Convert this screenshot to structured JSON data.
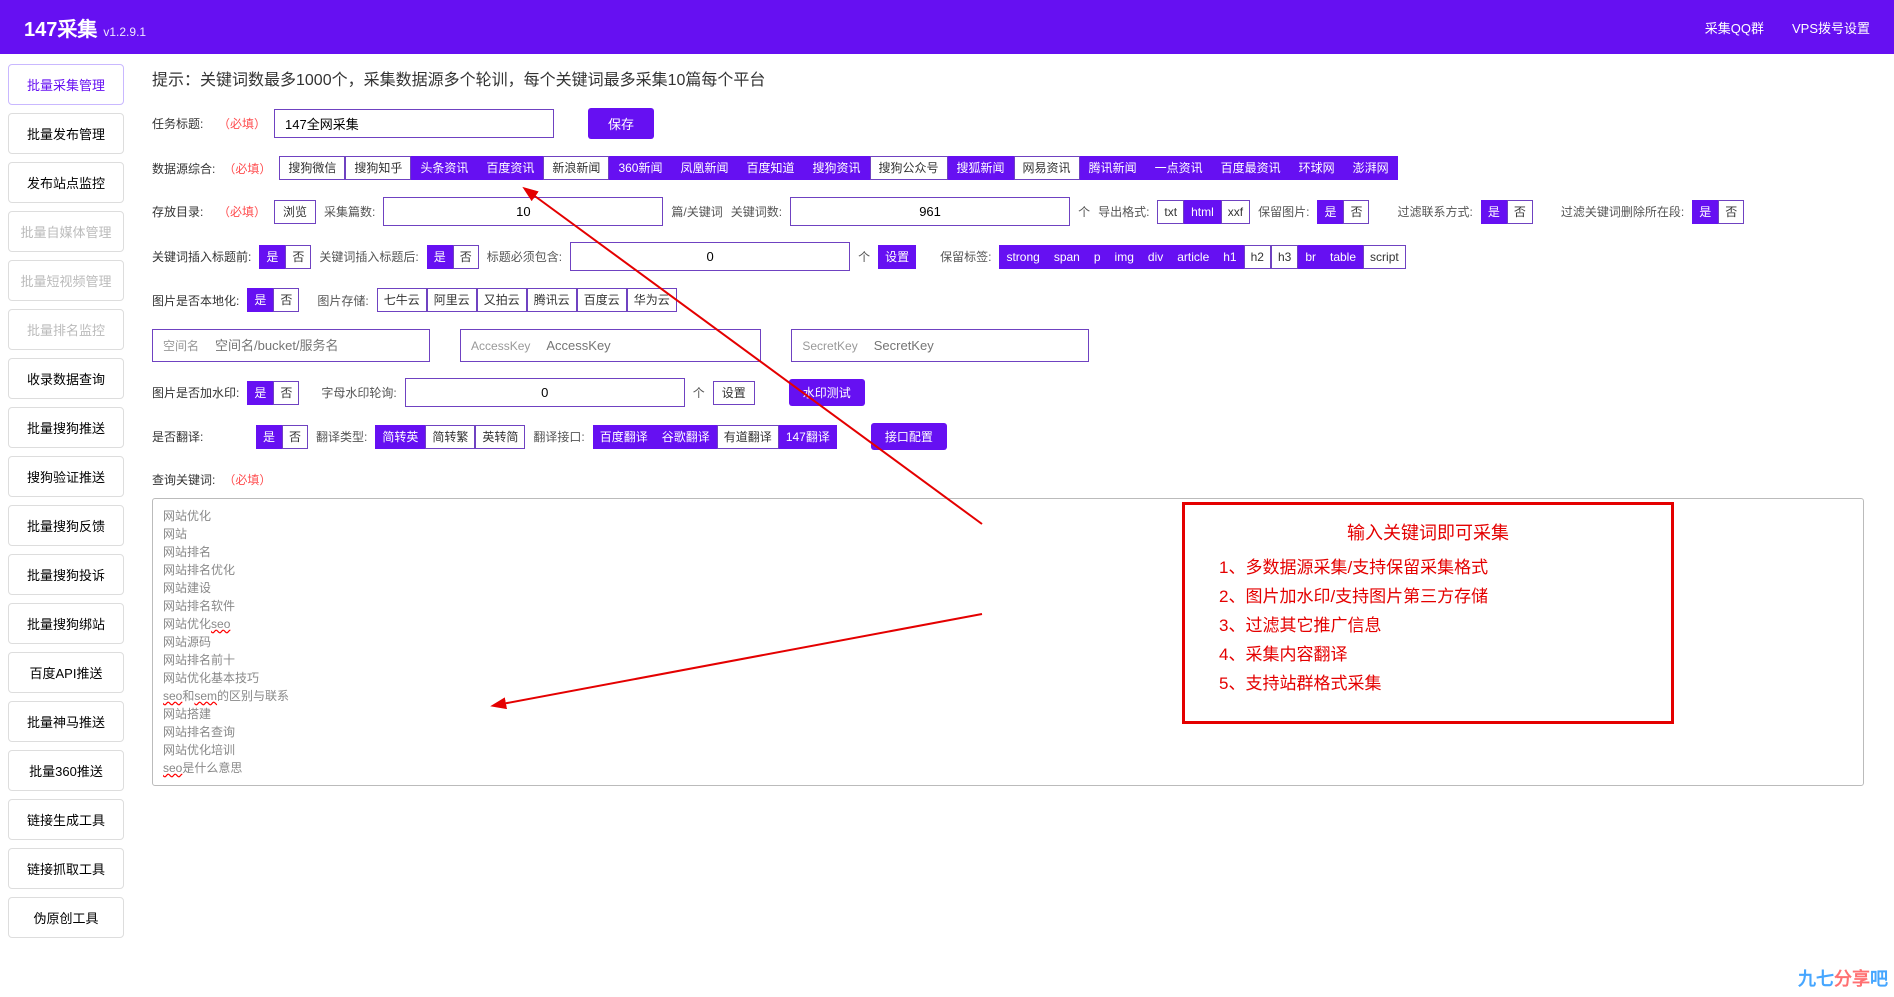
{
  "header": {
    "brand": "147采集",
    "version": "v1.2.9.1",
    "links": [
      "采集QQ群",
      "VPS拨号设置"
    ]
  },
  "sidebar": [
    {
      "label": "批量采集管理",
      "state": "active"
    },
    {
      "label": "批量发布管理",
      "state": ""
    },
    {
      "label": "发布站点监控",
      "state": ""
    },
    {
      "label": "批量自媒体管理",
      "state": "disabled"
    },
    {
      "label": "批量短视频管理",
      "state": "disabled"
    },
    {
      "label": "批量排名监控",
      "state": "disabled"
    },
    {
      "label": "收录数据查询",
      "state": ""
    },
    {
      "label": "批量搜狗推送",
      "state": ""
    },
    {
      "label": "搜狗验证推送",
      "state": ""
    },
    {
      "label": "批量搜狗反馈",
      "state": ""
    },
    {
      "label": "批量搜狗投诉",
      "state": ""
    },
    {
      "label": "批量搜狗绑站",
      "state": ""
    },
    {
      "label": "百度API推送",
      "state": ""
    },
    {
      "label": "批量神马推送",
      "state": ""
    },
    {
      "label": "批量360推送",
      "state": ""
    },
    {
      "label": "链接生成工具",
      "state": ""
    },
    {
      "label": "链接抓取工具",
      "state": ""
    },
    {
      "label": "伪原创工具",
      "state": ""
    }
  ],
  "tip": "提示：关键词数最多1000个，采集数据源多个轮训，每个关键词最多采集10篇每个平台",
  "task": {
    "label": "任务标题:",
    "required": "（必填）",
    "value": "147全网采集",
    "save": "保存"
  },
  "sources": {
    "label": "数据源综合:",
    "required": "（必填）",
    "items": [
      {
        "label": "搜狗微信",
        "on": false
      },
      {
        "label": "搜狗知乎",
        "on": false
      },
      {
        "label": "头条资讯",
        "on": true
      },
      {
        "label": "百度资讯",
        "on": true
      },
      {
        "label": "新浪新闻",
        "on": false
      },
      {
        "label": "360新闻",
        "on": true
      },
      {
        "label": "凤凰新闻",
        "on": true
      },
      {
        "label": "百度知道",
        "on": true
      },
      {
        "label": "搜狗资讯",
        "on": true
      },
      {
        "label": "搜狗公众号",
        "on": false
      },
      {
        "label": "搜狐新闻",
        "on": true
      },
      {
        "label": "网易资讯",
        "on": false
      },
      {
        "label": "腾讯新闻",
        "on": true
      },
      {
        "label": "一点资讯",
        "on": true
      },
      {
        "label": "百度最资讯",
        "on": true
      },
      {
        "label": "环球网",
        "on": true
      },
      {
        "label": "澎湃网",
        "on": true
      }
    ]
  },
  "dir": {
    "label": "存放目录:",
    "required": "（必填）",
    "browse": "浏览",
    "count_label": "采集篇数:",
    "count": "10",
    "count_suffix": "篇/关键词",
    "kw_label": "关键词数:",
    "kw": "961",
    "kw_suffix": "个",
    "export_label": "导出格式:",
    "export": [
      {
        "label": "txt",
        "on": false
      },
      {
        "label": "html",
        "on": true
      },
      {
        "label": "xxf",
        "on": false
      }
    ],
    "keepimg_label": "保留图片:",
    "keepimg": [
      {
        "label": "是",
        "on": true
      },
      {
        "label": "否",
        "on": false
      }
    ],
    "filter_label": "过滤联系方式:",
    "filter": [
      {
        "label": "是",
        "on": true
      },
      {
        "label": "否",
        "on": false
      }
    ],
    "filter2_label": "过滤关键词删除所在段:",
    "filter2": [
      {
        "label": "是",
        "on": true
      },
      {
        "label": "否",
        "on": false
      }
    ]
  },
  "insert": {
    "before_label": "关键词插入标题前:",
    "before": [
      {
        "label": "是",
        "on": true
      },
      {
        "label": "否",
        "on": false
      }
    ],
    "after_label": "关键词插入标题后:",
    "after": [
      {
        "label": "是",
        "on": true
      },
      {
        "label": "否",
        "on": false
      }
    ],
    "must_label": "标题必须包含:",
    "must_val": "0",
    "must_suffix": "个",
    "set": "设置",
    "keep_tag_label": "保留标签:",
    "tags": [
      {
        "label": "strong",
        "on": true
      },
      {
        "label": "span",
        "on": true
      },
      {
        "label": "p",
        "on": true
      },
      {
        "label": "img",
        "on": true
      },
      {
        "label": "div",
        "on": true
      },
      {
        "label": "article",
        "on": true
      },
      {
        "label": "h1",
        "on": true
      },
      {
        "label": "h2",
        "on": false
      },
      {
        "label": "h3",
        "on": false
      },
      {
        "label": "br",
        "on": true
      },
      {
        "label": "table",
        "on": true
      },
      {
        "label": "script",
        "on": false
      }
    ]
  },
  "imglocal": {
    "label": "图片是否本地化:",
    "opts": [
      {
        "label": "是",
        "on": true
      },
      {
        "label": "否",
        "on": false
      }
    ],
    "store_label": "图片存储:",
    "stores": [
      {
        "label": "七牛云",
        "on": false
      },
      {
        "label": "阿里云",
        "on": false
      },
      {
        "label": "又拍云",
        "on": false
      },
      {
        "label": "腾讯云",
        "on": false
      },
      {
        "label": "百度云",
        "on": false
      },
      {
        "label": "华为云",
        "on": false
      }
    ]
  },
  "cloud": {
    "space_pre": "空间名",
    "space_ph": "空间名/bucket/服务名",
    "ak_pre": "AccessKey",
    "ak_ph": "AccessKey",
    "sk_pre": "SecretKey",
    "sk_ph": "SecretKey"
  },
  "watermark": {
    "label": "图片是否加水印:",
    "opts": [
      {
        "label": "是",
        "on": true
      },
      {
        "label": "否",
        "on": false
      }
    ],
    "rotate_label": "字母水印轮询:",
    "rotate_val": "0",
    "rotate_suffix": "个",
    "set": "设置",
    "test": "水印测试"
  },
  "translate": {
    "label": "是否翻译:",
    "opts": [
      {
        "label": "是",
        "on": true
      },
      {
        "label": "否",
        "on": false
      }
    ],
    "type_label": "翻译类型:",
    "types": [
      {
        "label": "简转英",
        "on": true
      },
      {
        "label": "简转繁",
        "on": false
      },
      {
        "label": "英转简",
        "on": false
      }
    ],
    "api_label": "翻译接口:",
    "apis": [
      {
        "label": "百度翻译",
        "on": true
      },
      {
        "label": "谷歌翻译",
        "on": true
      },
      {
        "label": "有道翻译",
        "on": false
      },
      {
        "label": "147翻译",
        "on": true
      }
    ],
    "config": "接口配置"
  },
  "query": {
    "label": "查询关键词:",
    "required": "（必填）",
    "list": [
      "网站优化",
      "网站",
      "网站排名",
      "网站排名优化",
      "网站建设",
      "网站排名软件",
      "网站优化seo",
      "网站源码",
      "网站排名前十",
      "网站优化基本技巧",
      "seo和sem的区别与联系",
      "网站搭建",
      "网站排名查询",
      "网站优化培训",
      "seo是什么意思"
    ]
  },
  "annotation": {
    "title": "输入关键词即可采集",
    "lines": [
      "1、多数据源采集/支持保留采集格式",
      "2、图片加水印/支持图片第三方存储",
      "3、过滤其它推广信息",
      "4、采集内容翻译",
      "5、支持站群格式采集"
    ]
  },
  "corner": {
    "a": "九七",
    "b": "分享",
    "c": "吧"
  }
}
